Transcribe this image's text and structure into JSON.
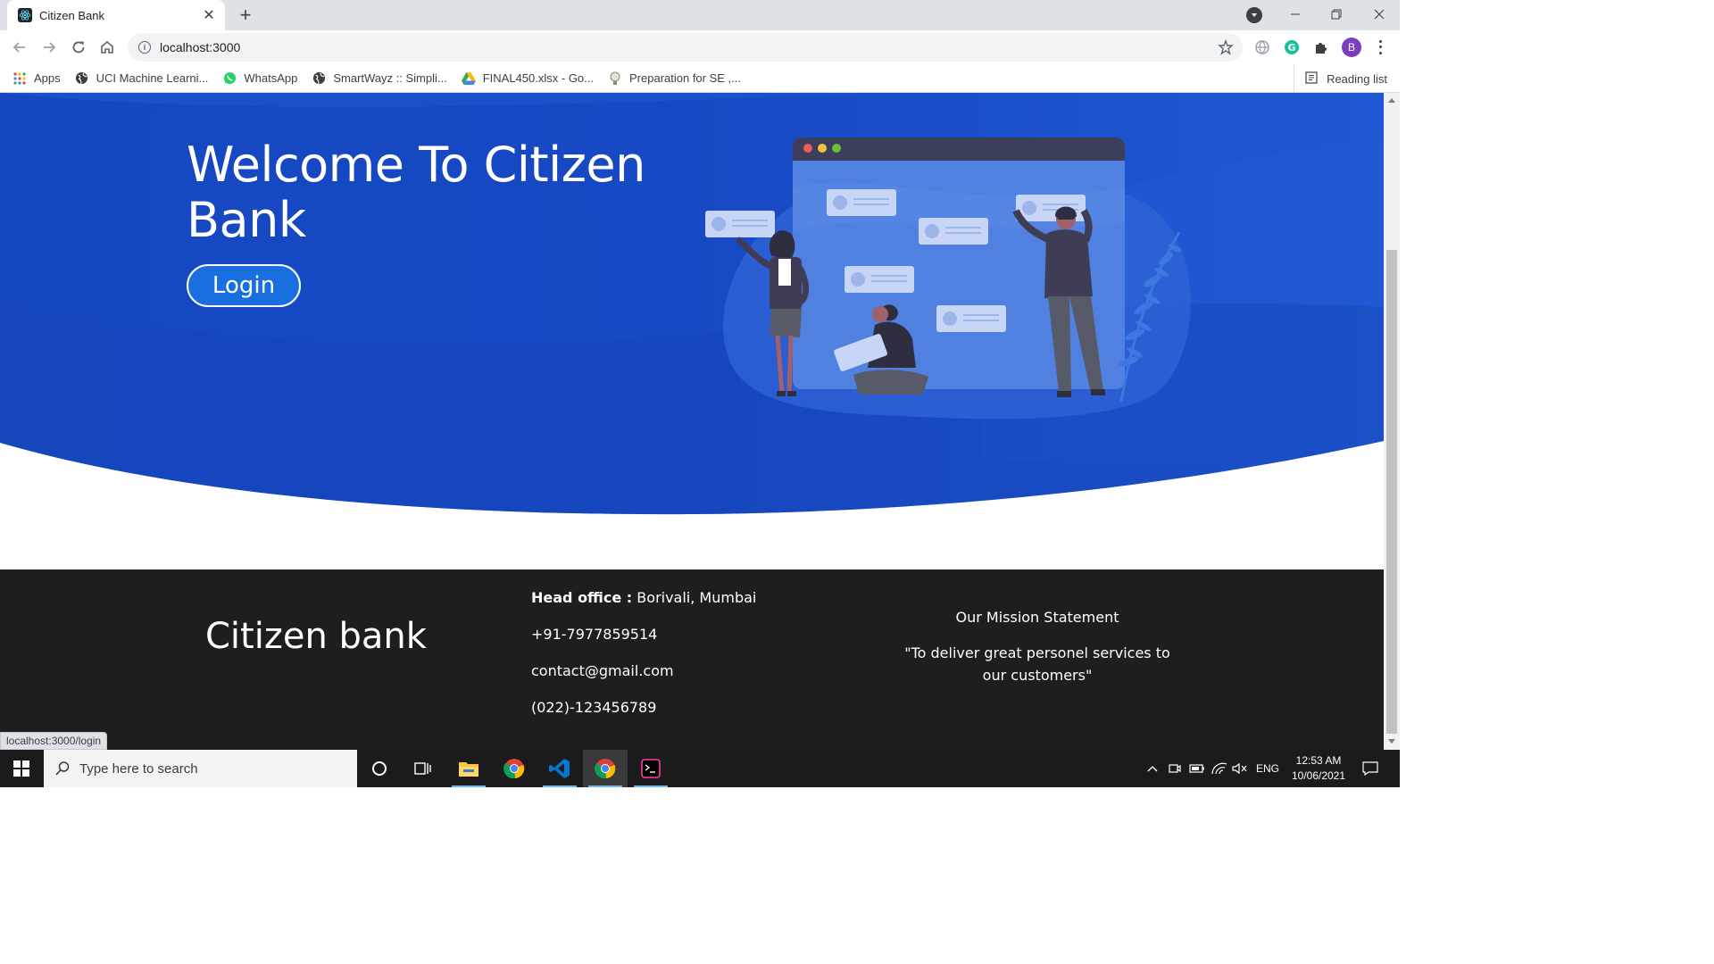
{
  "browser": {
    "tab_title": "Citizen Bank",
    "url": "localhost:3000",
    "profile_initial": "B",
    "bookmarks": [
      {
        "label": "Apps",
        "icon": "apps-grid-icon"
      },
      {
        "label": "UCI Machine Learni...",
        "icon": "globe-icon"
      },
      {
        "label": "WhatsApp",
        "icon": "whatsapp-icon"
      },
      {
        "label": "SmartWayz :: Simpli...",
        "icon": "globe-icon"
      },
      {
        "label": "FINAL450.xlsx - Go...",
        "icon": "google-drive-icon"
      },
      {
        "label": "Preparation for SE ,...",
        "icon": "bulb-icon"
      }
    ],
    "reading_list": "Reading list",
    "status_url": "localhost:3000/login"
  },
  "hero": {
    "title": "Welcome To Citizen Bank",
    "login_label": "Login",
    "colors": {
      "primary": "#1748c4",
      "button": "#1a6fe0"
    }
  },
  "footer": {
    "brand": "Citizen bank",
    "head_office_label": "Head office :",
    "head_office_value": "Borivali, Mumbai",
    "phone": "+91-7977859514",
    "email": "contact@gmail.com",
    "landline": "(022)-123456789",
    "mission_title": "Our Mission Statement",
    "mission_text": "\"To deliver great personel services to our customers\""
  },
  "taskbar": {
    "search_placeholder": "Type here to search",
    "language": "ENG",
    "time": "12:53 AM",
    "date": "10/06/2021"
  }
}
